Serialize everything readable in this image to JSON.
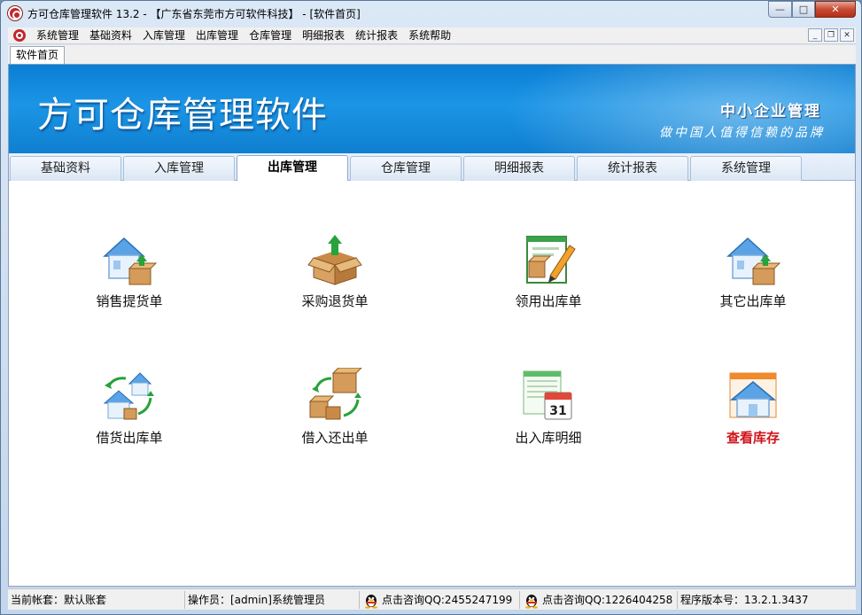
{
  "window": {
    "title": "方可仓库管理软件 13.2 - 【广东省东莞市方可软件科技】 - [软件首页]",
    "controls": {
      "minimize": "—",
      "maximize": "□",
      "close": "✕"
    }
  },
  "menubar": {
    "items": [
      "系统管理",
      "基础资料",
      "入库管理",
      "出库管理",
      "仓库管理",
      "明细报表",
      "统计报表",
      "系统帮助"
    ],
    "mdi": {
      "minimize": "_",
      "restore": "❐",
      "close": "✕"
    }
  },
  "doc_tab": {
    "label": "软件首页"
  },
  "banner": {
    "title": "方可仓库管理软件",
    "sub1": "中小企业管理",
    "sub2": "做中国人值得信赖的品牌"
  },
  "tabs": [
    {
      "label": "基础资料"
    },
    {
      "label": "入库管理"
    },
    {
      "label": "出库管理"
    },
    {
      "label": "仓库管理"
    },
    {
      "label": "明细报表"
    },
    {
      "label": "统计报表"
    },
    {
      "label": "系统管理"
    }
  ],
  "active_tab": "出库管理",
  "tiles": [
    {
      "label": "销售提货单",
      "icon": "house-box-icon"
    },
    {
      "label": "采购退货单",
      "icon": "open-box-icon"
    },
    {
      "label": "领用出库单",
      "icon": "form-pencil-icon"
    },
    {
      "label": "其它出库单",
      "icon": "house-box-icon"
    },
    {
      "label": "借货出库单",
      "icon": "house-exchange-icon"
    },
    {
      "label": "借入还出单",
      "icon": "box-exchange-icon"
    },
    {
      "label": "出入库明细",
      "icon": "calendar-icon"
    },
    {
      "label": "查看库存",
      "icon": "house-window-icon"
    }
  ],
  "status": {
    "account": "当前帐套：默认账套",
    "operator": "操作员：[admin]系统管理员",
    "qq1": "点击咨询QQ:2455247199",
    "qq2": "点击咨询QQ:1226404258",
    "version": "程序版本号：13.2.1.3437"
  },
  "colors": {
    "accent": "#1c95e6",
    "highlight_label": "#d0141a"
  }
}
